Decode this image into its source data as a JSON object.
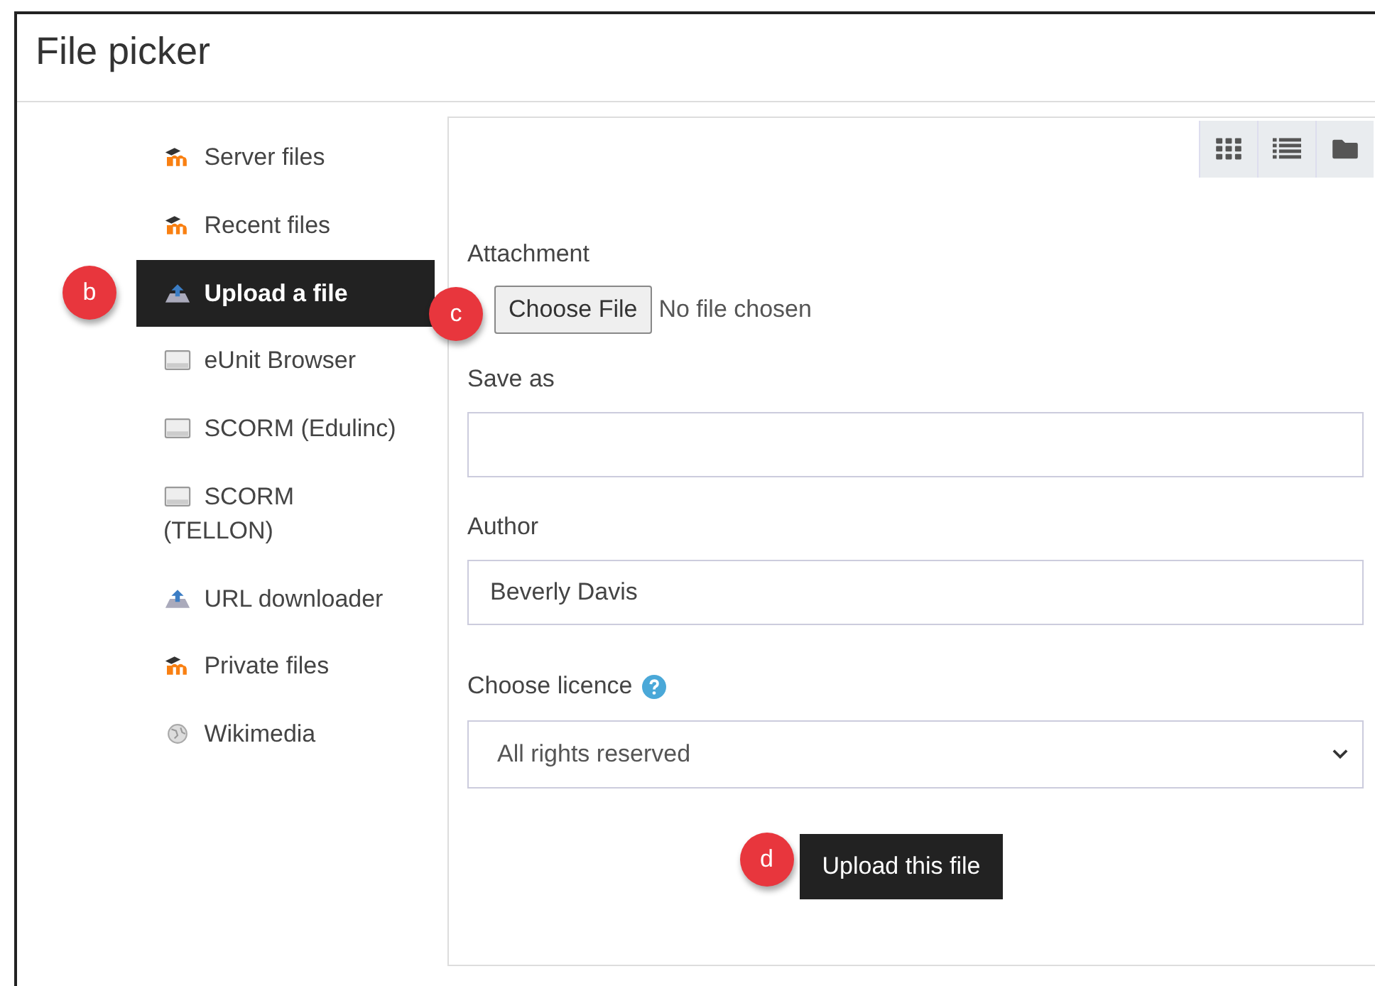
{
  "window": {
    "title": "File picker"
  },
  "sidebar": {
    "items": [
      {
        "label": "Server files",
        "kind": "moodle",
        "selected": false
      },
      {
        "label": "Recent files",
        "kind": "moodle",
        "selected": false
      },
      {
        "label": "Upload a file",
        "kind": "upload",
        "selected": true,
        "callout": "b"
      },
      {
        "label": "eUnit Browser",
        "kind": "repository",
        "selected": false
      },
      {
        "label": "SCORM (Edulinc)",
        "kind": "repository",
        "selected": false
      },
      {
        "label": "SCORM (TELLON)",
        "kind": "repository",
        "selected": false
      },
      {
        "label": "URL downloader",
        "kind": "upload",
        "selected": false
      },
      {
        "label": "Private files",
        "kind": "moodle",
        "selected": false
      },
      {
        "label": "Wikimedia",
        "kind": "globe",
        "selected": false
      }
    ]
  },
  "toolbar": [
    {
      "kind": "grid",
      "selected": false
    },
    {
      "kind": "list",
      "selected": false
    },
    {
      "kind": "folder",
      "selected": false
    }
  ],
  "form": {
    "attachment": {
      "label": "Attachment",
      "button": "Choose File",
      "status": "No file chosen",
      "callout": "c"
    },
    "save_as": {
      "label": "Save as"
    },
    "author": {
      "label": "Author",
      "value": "Beverly Davis"
    },
    "licence": {
      "label": "Choose licence",
      "value": "All rights reserved"
    },
    "submit": {
      "label": "Upload this file",
      "callout": "d"
    }
  }
}
